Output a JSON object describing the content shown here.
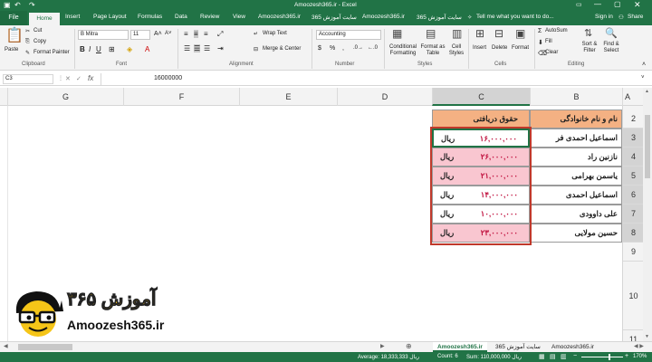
{
  "title": {
    "text": "Amoozesh365.ir - Excel",
    "signin": "Sign in",
    "share": "Share",
    "tellme": "Tell me what you want to do..."
  },
  "tabs": [
    "File",
    "Home",
    "Insert",
    "Page Layout",
    "Formulas",
    "Data",
    "Review",
    "View",
    "Amoozesh365.ir",
    "سایت آموزش 365",
    "Amoozesh365.ir",
    "سایت آموزش 365"
  ],
  "ribbon": {
    "paste": "Paste",
    "cut": "Cut",
    "copy": "Copy",
    "format_painter": "Format Painter",
    "font_name": "B Mitra",
    "font_size": "11",
    "wrap_text": "Wrap Text",
    "merge_center": "Merge & Center",
    "number_format": "Accounting",
    "conditional": "Conditional Formatting",
    "format_as": "Format as Table",
    "cell_styles": "Cell Styles",
    "insert": "Insert",
    "delete": "Delete",
    "format": "Format",
    "autosum": "AutoSum",
    "fill": "Fill",
    "clear": "Clear",
    "sort_filter": "Sort & Filter",
    "find_select": "Find & Select",
    "groups": {
      "clipboard": "Clipboard",
      "font": "Font",
      "alignment": "Alignment",
      "number": "Number",
      "styles": "Styles",
      "cells": "Cells",
      "editing": "Editing"
    }
  },
  "formula_bar": {
    "name_box": "C3",
    "value": "16000000"
  },
  "columns": [
    "G",
    "F",
    "E",
    "D",
    "C",
    "B",
    "A"
  ],
  "rows": [
    "2",
    "3",
    "4",
    "5",
    "6",
    "7",
    "8",
    "9",
    "10",
    "11"
  ],
  "table": {
    "header_name": "نام و نام خانوادگی",
    "header_salary": "حقوق دریافتی",
    "unit": "ریال",
    "rows": [
      {
        "name": "اسماعیل احمدی فر",
        "salary": "۱۶,۰۰۰,۰۰۰"
      },
      {
        "name": "نازنین راد",
        "salary": "۲۶,۰۰۰,۰۰۰"
      },
      {
        "name": "یاسمن بهرامی",
        "salary": "۲۱,۰۰۰,۰۰۰"
      },
      {
        "name": "اسماعیل احمدی",
        "salary": "۱۴,۰۰۰,۰۰۰"
      },
      {
        "name": "علی داوودی",
        "salary": "۱۰,۰۰۰,۰۰۰"
      },
      {
        "name": "حسین مولایی",
        "salary": "۲۳,۰۰۰,۰۰۰"
      }
    ]
  },
  "logo": {
    "persian": "آموزش ۳۶۵",
    "site": "Amoozesh365.ir"
  },
  "sheets": [
    "Amoozesh365.ir",
    "سایت آموزش 365",
    "Amoozesh365.ir"
  ],
  "status": {
    "average": "Average: 18,333,333 ریال",
    "count": "Count: 6",
    "sum": "Sum: 110,000,000 ریال",
    "zoom": "170%"
  },
  "colors": {
    "excel_green": "#217346",
    "header_fill": "#f4b183",
    "highlight_fill": "#f9c6d0",
    "salary_text": "#c0113e",
    "selection_border": "#c0392b",
    "logo_yellow": "#f5c518"
  }
}
